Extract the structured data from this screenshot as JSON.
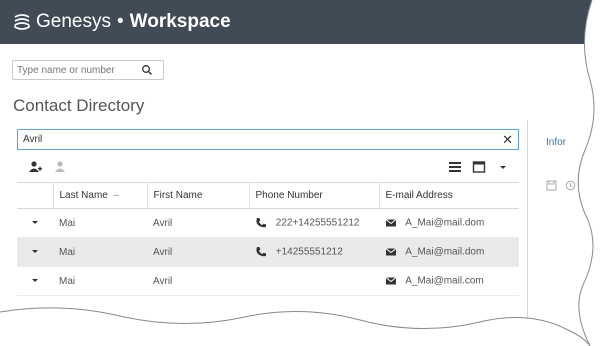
{
  "app": {
    "brand": "Genesys",
    "separator": "•",
    "product": "Workspace"
  },
  "search": {
    "value": "",
    "placeholder": "Type name or number"
  },
  "directory": {
    "title": "Contact Directory",
    "filter_value": "Avril",
    "clear_label": "✕"
  },
  "table": {
    "columns": [
      "Last Name",
      "First Name",
      "Phone Number",
      "E-mail Address"
    ],
    "sort_indicator": "–",
    "rows": [
      {
        "last": "Mai",
        "first": "Avril",
        "phone": "222+14255551212",
        "email": "A_Mai@mail.dom"
      },
      {
        "last": "Mai",
        "first": "Avril",
        "phone": "+14255551212",
        "email": "A_Mai@mail.dom"
      },
      {
        "last": "Mai",
        "first": "Avril",
        "phone": "",
        "email": "A_Mai@mail.com"
      }
    ]
  },
  "right_panel": {
    "tab_label": "Infor"
  },
  "colors": {
    "titlebar": "#414b55",
    "accent": "#2a7ab8",
    "alt_row": "#eaeaea"
  }
}
